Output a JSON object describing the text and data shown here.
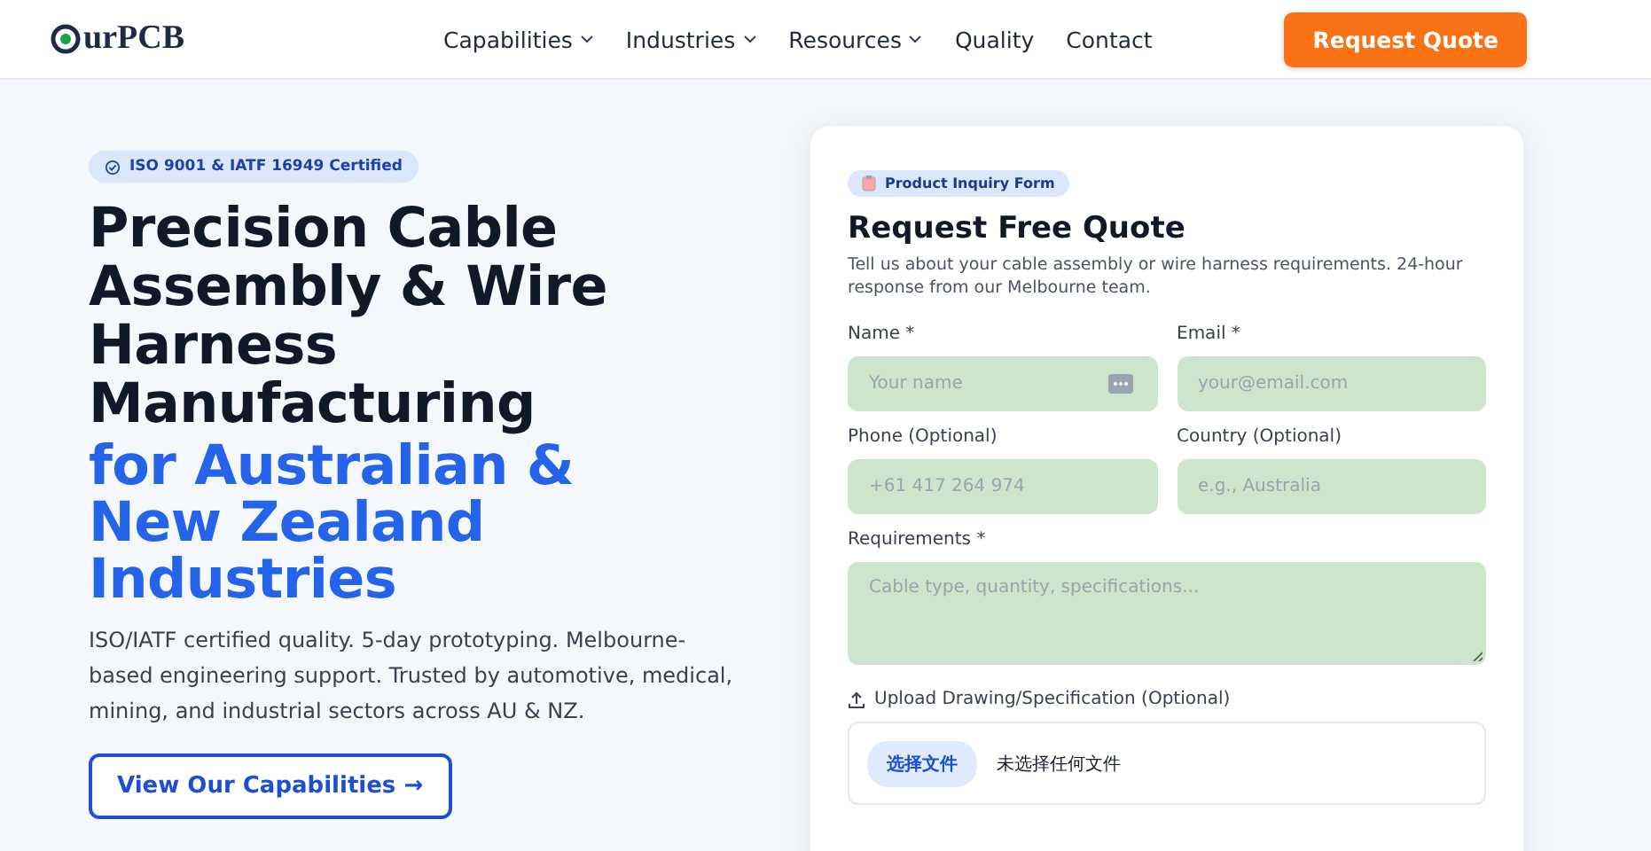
{
  "header": {
    "logo": "urPCB",
    "nav": [
      {
        "label": "Capabilities",
        "dropdown": true
      },
      {
        "label": "Industries",
        "dropdown": true
      },
      {
        "label": "Resources",
        "dropdown": true
      },
      {
        "label": "Quality",
        "dropdown": false
      },
      {
        "label": "Contact",
        "dropdown": false
      }
    ],
    "cta": "Request Quote"
  },
  "hero": {
    "badge": "ISO 9001 & IATF 16949 Certified",
    "title_dark": "Precision Cable Assembly & Wire Harness Manufacturing",
    "title_accent": "for Australian & New Zealand Industries",
    "description": "ISO/IATF certified quality. 5-day prototyping. Melbourne-based engineering support. Trusted by automotive, medical, mining, and industrial sectors across AU & NZ.",
    "button": "View Our Capabilities →"
  },
  "form": {
    "badge": "Product Inquiry Form",
    "title": "Request Free Quote",
    "subtitle": "Tell us about your cable assembly or wire harness requirements. 24-hour response from our Melbourne team.",
    "fields": [
      {
        "kind": "input",
        "label": "Name *",
        "placeholder": "Your name",
        "autofill_icon": true
      },
      {
        "kind": "input",
        "label": "Email *",
        "placeholder": "your@email.com",
        "autofill_icon": false
      },
      {
        "kind": "input",
        "label": "Phone (Optional)",
        "placeholder": "+61 417 264 974",
        "autofill_icon": false
      },
      {
        "kind": "input",
        "label": "Country (Optional)",
        "placeholder": "e.g., Australia",
        "autofill_icon": false
      },
      {
        "kind": "textarea",
        "label": "Requirements *",
        "placeholder": "Cable type, quantity, specifications...",
        "autofill_icon": false
      }
    ],
    "upload": {
      "label": "Upload Drawing/Specification (Optional)",
      "button": "选择文件",
      "status": "未选择任何文件"
    }
  }
}
